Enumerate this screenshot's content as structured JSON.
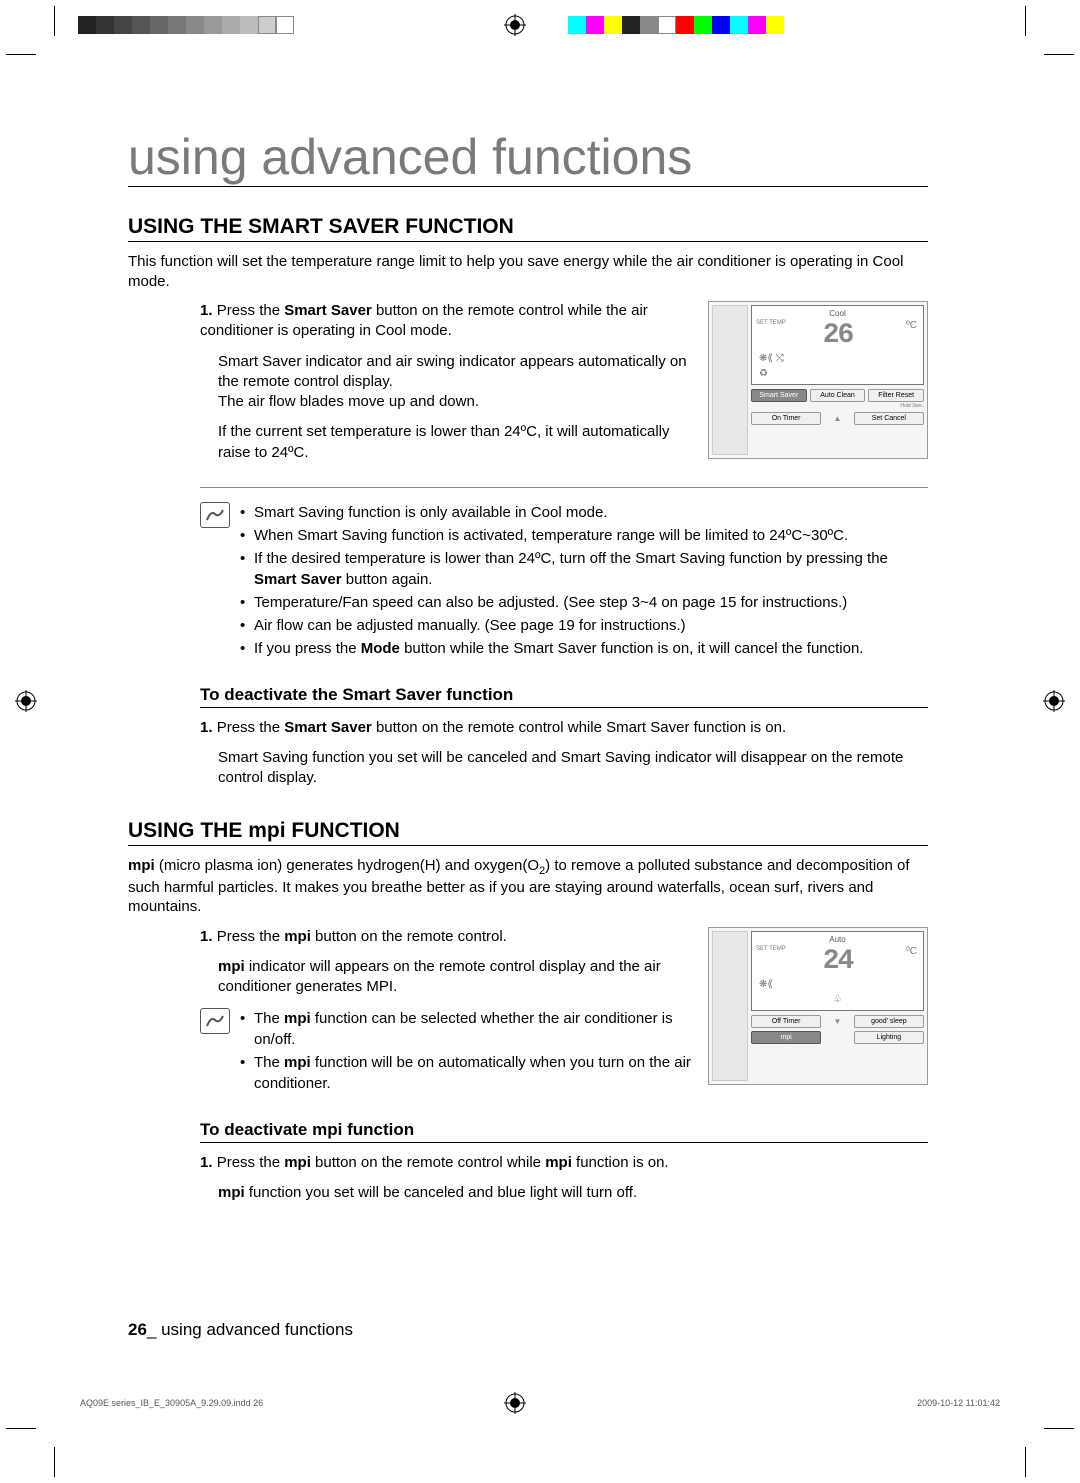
{
  "page": {
    "title": "using advanced functions",
    "footer_page": "26_ using advanced functions",
    "footer_file": "AQ09E series_IB_E_30905A_9.29.09.indd   26",
    "footer_date": "2009-10-12   11:01:42"
  },
  "smart_saver": {
    "heading": "USING THE SMART SAVER FUNCTION",
    "intro": "This function will set the temperature range limit to help you save energy while the air conditioner is operating in Cool mode.",
    "step1_num": "1.",
    "step1_a_pre": "Press the ",
    "step1_a_bold": "Smart Saver",
    "step1_a_post": " button on the remote control while the air conditioner is operating in Cool mode.",
    "step1_b": "Smart Saver indicator and air swing indicator appears automatically on the remote control display.",
    "step1_c": "The air flow blades move up and down.",
    "step1_d": "If the current set temperature is lower than 24ºC, it will automatically raise to 24ºC.",
    "notes": {
      "n1": "Smart Saving function is only available in Cool mode.",
      "n2": "When Smart Saving function is activated, temperature range will be limited to 24ºC~30ºC.",
      "n3_pre": "If the desired temperature is lower than 24ºC, turn off the Smart Saving function by pressing the ",
      "n3_bold": "Smart Saver",
      "n3_post": " button again.",
      "n4": "Temperature/Fan speed can also be adjusted. (See step 3~4 on page 15 for instructions.)",
      "n5": "Air flow can be adjusted manually. (See page 19 for instructions.)",
      "n6_pre": "If you press the ",
      "n6_bold": "Mode",
      "n6_post": " button while the Smart Saver function is on, it will cancel the function."
    },
    "deactivate": {
      "heading": "To deactivate the Smart Saver function",
      "step1_num": "1.",
      "step1_pre": "Press the ",
      "step1_bold": "Smart Saver",
      "step1_post": " button on the remote control while Smart Saver function is on.",
      "result": "Smart Saving function you set will be canceled and Smart Saving indicator will disappear on the remote control display."
    },
    "remote": {
      "mode": "Cool",
      "settemp_label": "SET TEMP",
      "temp": "26",
      "unit": "ºC",
      "btn_smart": "Smart Saver",
      "btn_clean": "Auto Clean",
      "btn_filter": "Filter Reset",
      "hold": "Hold 3sec.",
      "btn_on": "On Timer",
      "btn_set": "Set Cancel",
      "arrow_up": "▲"
    }
  },
  "mpi": {
    "heading_pre": "USING THE ",
    "heading_word": "mpi",
    "heading_post": " FUNCTION",
    "intro_word": "mpi",
    "intro_text": " (micro plasma ion) generates hydrogen(H) and oxygen(O2) to remove a polluted substance and decomposition of such harmful particles. It makes you breathe better as if you are staying around waterfalls, ocean surf, rivers and mountains.",
    "step1_num": "1.",
    "step1_pre": "Press the ",
    "step1_word": "mpi",
    "step1_post": " button on the remote control.",
    "step1_b_word": "mpi",
    "step1_b_post": " indicator will appears on the remote control display and the air conditioner generates MPI.",
    "notes": {
      "n1_pre": "The ",
      "n1_word": "mpi",
      "n1_post": " function can be selected whether the air conditioner is on/off.",
      "n2_pre": "The ",
      "n2_word": "mpi",
      "n2_post": " function will be on automatically when you turn on the air conditioner."
    },
    "deactivate": {
      "heading_pre": "To deactivate ",
      "heading_word": "mpi",
      "heading_post": " function",
      "step1_num": "1.",
      "step1_pre": "Press the ",
      "step1_word1": "mpi",
      "step1_mid": " button on the remote control while ",
      "step1_word2": "mpi",
      "step1_post": " function is on.",
      "result_word": "mpi",
      "result_post": " function you set will be canceled and blue light will turn off."
    },
    "remote": {
      "mode": "Auto",
      "settemp_label": "SET TEMP",
      "temp": "24",
      "unit": "ºC",
      "btn_off": "Off Timer",
      "btn_sleep": "good' sleep",
      "btn_mpi": "mpi",
      "btn_light": "Lighting",
      "arrow_down": "▼"
    }
  },
  "colorbar1": [
    "#222",
    "#333",
    "#444",
    "#555",
    "#666",
    "#777",
    "#888",
    "#999",
    "#aaa",
    "#bbb",
    "#ccc",
    "#fff"
  ],
  "colorbar2": [
    "#0ff",
    "#f0f",
    "#ff0",
    "#222",
    "#888",
    "#fff",
    "#f00",
    "#0f0",
    "#00f",
    "#0ff",
    "#f0f",
    "#ff0"
  ]
}
